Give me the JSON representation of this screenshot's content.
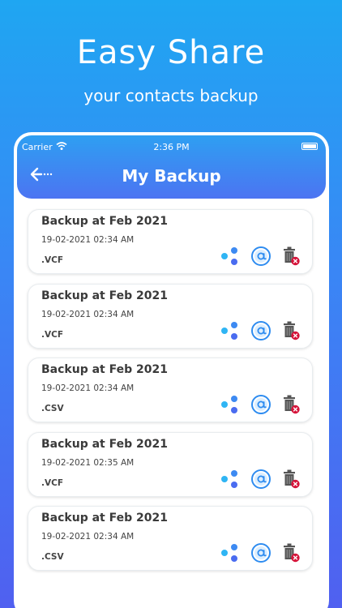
{
  "hero": {
    "title": "Easy Share",
    "subtitle": "your contacts backup"
  },
  "status_bar": {
    "carrier": "Carrier",
    "time": "2:36 PM"
  },
  "app_bar": {
    "title": "My Backup",
    "back_icon": "back-arrow-icon"
  },
  "colors": {
    "accent_top": "#1fa6f2",
    "accent_bottom": "#5060f0",
    "share_blue": "#2e8cf0",
    "delete_red": "#d6143a"
  },
  "backups": [
    {
      "name": "Backup at Feb 2021",
      "date": "19-02-2021 02:34 AM",
      "ext": ".VCF"
    },
    {
      "name": "Backup at Feb 2021",
      "date": "19-02-2021 02:34 AM",
      "ext": ".VCF"
    },
    {
      "name": "Backup at Feb 2021",
      "date": "19-02-2021 02:34 AM",
      "ext": ".CSV"
    },
    {
      "name": "Backup at Feb 2021",
      "date": "19-02-2021 02:35 AM",
      "ext": ".VCF"
    },
    {
      "name": "Backup at Feb 2021",
      "date": "19-02-2021 02:34 AM",
      "ext": ".CSV"
    }
  ],
  "actions": {
    "share_icon": "share-icon",
    "email_icon": "email-icon",
    "delete_icon": "delete-icon"
  }
}
